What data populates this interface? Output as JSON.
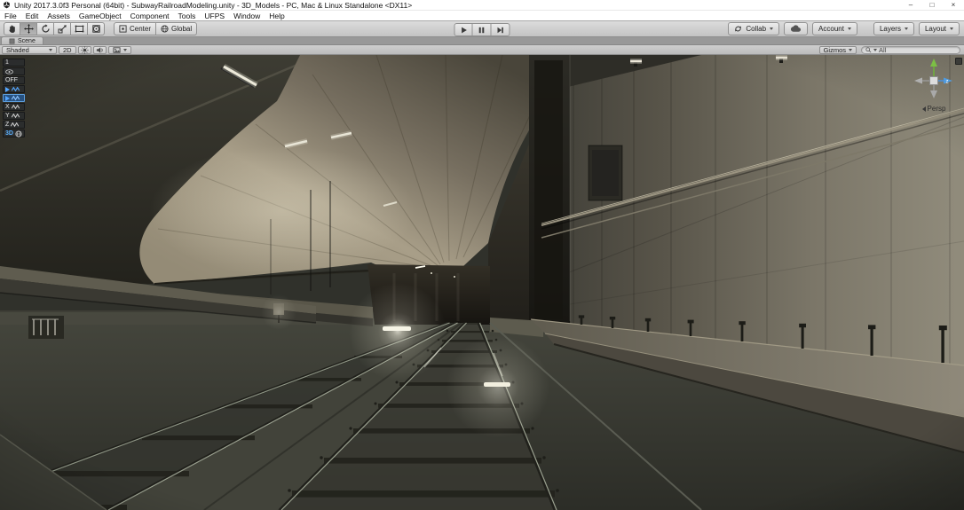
{
  "colors": {
    "accent_blue": "#4a90e2",
    "titlebar_bg": "#ffffff",
    "toolbar_bg": "#c9c9c9",
    "scene_bg": "#2e2f2a",
    "vault_tan": "#a89e88",
    "wall_beige": "#8f8a7a",
    "gizmo_green": "#7cbf45",
    "gizmo_blue": "#4f9be0",
    "overlay_blue": "#54a6ff"
  },
  "window": {
    "title": "Unity 2017.3.0f3 Personal (64bit) - SubwayRailroadModeling.unity - 3D_Models - PC, Mac & Linux Standalone <DX11>",
    "minimize": "–",
    "maximize": "□",
    "close": "×"
  },
  "menubar": {
    "items": [
      "File",
      "Edit",
      "Assets",
      "GameObject",
      "Component",
      "Tools",
      "UFPS",
      "Window",
      "Help"
    ]
  },
  "toolbar": {
    "pivot": "Center",
    "space": "Global",
    "collab": "Collab",
    "account": "Account",
    "layers": "Layers",
    "layout": "Layout"
  },
  "scene_panel": {
    "tab": "Scene",
    "shading": "Shaded",
    "mode2d": "2D",
    "gizmos": "Gizmos",
    "search_value": "All"
  },
  "scene_overlay": {
    "buttons": [
      {
        "label": "1"
      },
      {
        "label": ""
      },
      {
        "label": "OFF"
      },
      {
        "label": ""
      },
      {
        "label": ""
      },
      {
        "label": "X"
      },
      {
        "label": "Y"
      },
      {
        "label": "Z"
      },
      {
        "label": "3D"
      }
    ]
  },
  "view_gizmo": {
    "axis_z": "z",
    "projection": "Persp"
  }
}
